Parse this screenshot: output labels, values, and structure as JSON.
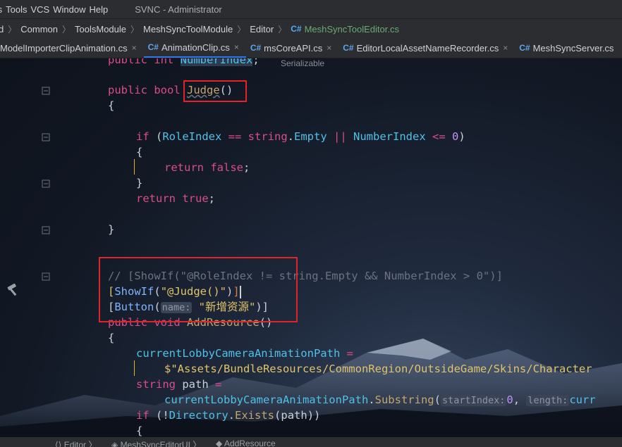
{
  "menu": {
    "items": [
      "ts",
      "Tools",
      "VCS",
      "Window",
      "Help"
    ],
    "window_title": "SVNC - Administrator"
  },
  "breadcrumb": {
    "items": [
      "d",
      "Common",
      "ToolsModule",
      "MeshSyncToolModule",
      "Editor"
    ],
    "last_badge": "C#",
    "last": "MeshSyncToolEditor.cs"
  },
  "tabs": [
    {
      "label": "ModelImporterClipAnimation.cs",
      "badge": "",
      "close": "×",
      "active": false
    },
    {
      "label": "AnimationClip.cs",
      "badge": "C#",
      "close": "×",
      "active": true
    },
    {
      "label": "msCoreAPI.cs",
      "badge": "C#",
      "close": "×",
      "active": false
    },
    {
      "label": "EditorLocalAssetNameRecorder.cs",
      "badge": "C#",
      "close": "×",
      "active": false
    },
    {
      "label": "MeshSyncServer.cs",
      "badge": "C#",
      "close": "",
      "active": false
    }
  ],
  "code": {
    "l0_a": "public ",
    "l0_b": "int ",
    "l0_c": "NumberIndex",
    "l0_d": ";",
    "serializable": "Serializable",
    "l1_a": "public ",
    "l1_b": "bool ",
    "l1_c": "Judge",
    "l1_d": "()",
    "brace_open": "{",
    "brace_close": "}",
    "l3_if": "if ",
    "l3_p1": "(",
    "l3_role": "RoleIndex",
    "l3_eq": " == ",
    "l3_string": "string",
    "l3_dot": ".",
    "l3_empty": "Empty",
    "l3_or": " || ",
    "l3_num": "NumberIndex",
    "l3_le": " <= ",
    "l3_zero": "0",
    "l3_p2": ")",
    "l5_ret": "return ",
    "l5_false": "false",
    "l5_semi": ";",
    "l7_ret": "return ",
    "l7_true": "true",
    "l7_semi": ";",
    "l10_comment": "// [ShowIf(\"@RoleIndex != string.Empty && NumberIndex > 0\")]",
    "l11_a": "[",
    "l11_b": "ShowIf",
    "l11_c": "(",
    "l11_d": "\"@Judge()\"",
    "l11_e": ")",
    "l11_f": "]",
    "l12_a": "[",
    "l12_b": "Button",
    "l12_c": "(",
    "l12_hint": "name:",
    "l12_d": "\"新增资源\"",
    "l12_e": ")]",
    "l13_a": "public ",
    "l13_b": "void ",
    "l13_c": "AddResource",
    "l13_d": "()",
    "l15_a": "currentLobbyCameraAnimationPath",
    "l15_b": " =",
    "l16_a": "$\"Assets/BundleResources/CommonRegion/OutsideGame/Skins/Character",
    "l17_a": "string ",
    "l17_b": "path",
    "l17_c": " =",
    "l18_a": "currentLobbyCameraAnimationPath",
    "l18_b": ".",
    "l18_c": "Substring",
    "l18_d": "(",
    "l18_hint1": "startIndex:",
    "l18_e": "0",
    "l18_f": ", ",
    "l18_hint2": "length:",
    "l18_g": "curr",
    "l19_a": "if ",
    "l19_b": "(!",
    "l19_c": "Directory",
    "l19_d": ".",
    "l19_e": "Exists",
    "l19_f": "(",
    "l19_g": "path",
    "l19_h": "))",
    "l20_a": "{"
  },
  "nav": {
    "items": [
      "Editor",
      "MeshSyncEditorUI",
      "AddResource"
    ]
  }
}
